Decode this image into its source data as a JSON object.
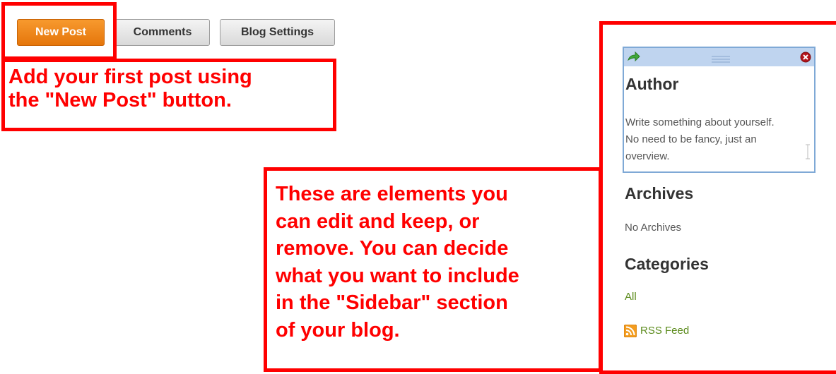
{
  "toolbar": {
    "new_post_label": "New Post",
    "comments_label": "Comments",
    "blog_settings_label": "Blog Settings"
  },
  "callouts": {
    "first_post_line1": "Add your first post using",
    "first_post_line2": "the \"New Post\" button.",
    "sidebar_line1": "These are elements you",
    "sidebar_line2": "can edit and keep, or",
    "sidebar_line3": "remove.  You can decide",
    "sidebar_line4": "what you want to include",
    "sidebar_line5": "in the \"Sidebar\" section",
    "sidebar_line6": "of your blog."
  },
  "sidebar": {
    "author_heading": "Author",
    "author_line1": "Write something about yourself.",
    "author_line2": "No need to be fancy, just an",
    "author_line3": "overview.",
    "archives_heading": "Archives",
    "archives_text": "No Archives",
    "categories_heading": "Categories",
    "categories_all": "All",
    "rss_label": "RSS Feed"
  },
  "colors": {
    "callout_red": "#ff0000",
    "primary_orange": "#e5760b",
    "link_green": "#5a8a1a",
    "widget_border": "#7fa9d6"
  },
  "icons": [
    "move-arrow-icon",
    "drag-handle-icon",
    "close-icon",
    "rss-icon"
  ]
}
